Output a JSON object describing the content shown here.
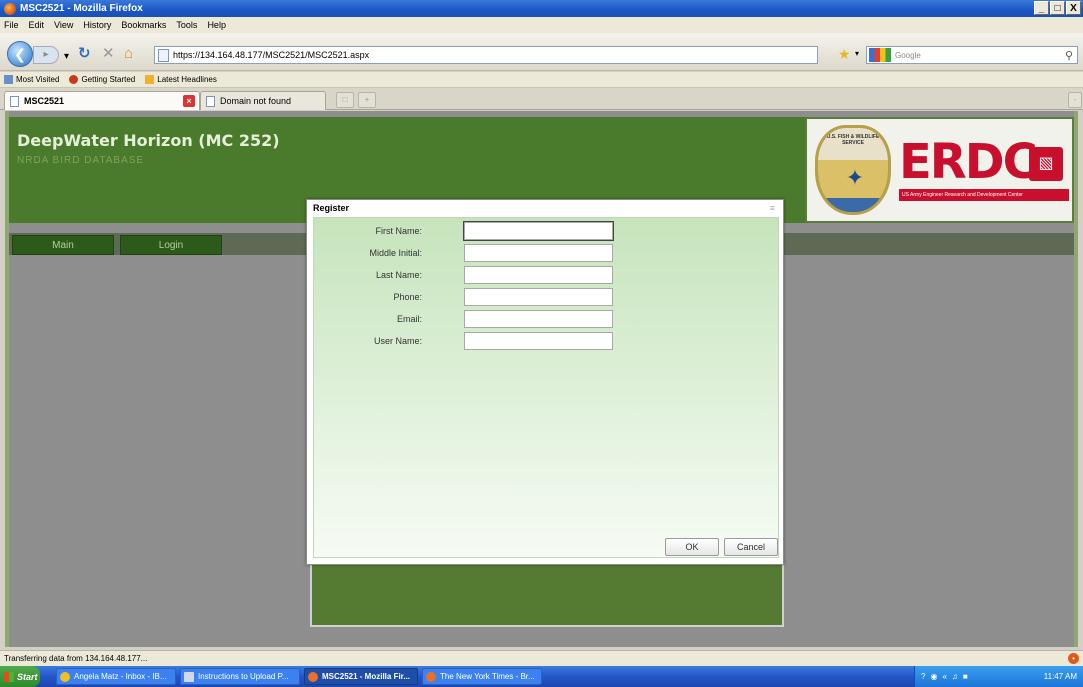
{
  "window": {
    "title": "MSC2521 - Mozilla Firefox",
    "controls": [
      "_",
      "□",
      "X"
    ]
  },
  "menu": [
    "File",
    "Edit",
    "View",
    "History",
    "Bookmarks",
    "Tools",
    "Help"
  ],
  "nav": {
    "url": "https://134.164.48.177/MSC2521/MSC2521.aspx",
    "search_placeholder": "Google"
  },
  "bookmarks": [
    "Most Visited",
    "Getting Started",
    "Latest Headlines"
  ],
  "tabs": [
    {
      "label": "MSC2521",
      "active": true
    },
    {
      "label": "Domain not found",
      "active": false
    }
  ],
  "page": {
    "title": "DeepWater Horizon (MC 252)",
    "subtitle": "NRDA BIRD DATABASE",
    "nav_buttons": [
      "Main",
      "Login"
    ],
    "logos": {
      "usfws_text": "U.S. FISH & WILDLIFE SERVICE",
      "erdc": "ERDC",
      "erdc_tagline": "US Army Engineer Research and Development Center"
    }
  },
  "dialog": {
    "title": "Register",
    "close_glyph": "≡",
    "fields": [
      {
        "label": "First Name:",
        "value": ""
      },
      {
        "label": "Middle Initial:",
        "value": ""
      },
      {
        "label": "Last Name:",
        "value": ""
      },
      {
        "label": "Phone:",
        "value": ""
      },
      {
        "label": "Email:",
        "value": ""
      },
      {
        "label": "User Name:",
        "value": ""
      }
    ],
    "ok_label": "OK",
    "cancel_label": "Cancel"
  },
  "status": {
    "text": "Transferring data from 134.164.48.177..."
  },
  "taskbar": {
    "start": "Start",
    "tasks": [
      {
        "label": "Angela Matz - Inbox - IB...",
        "color": "#f0c020"
      },
      {
        "label": "Instructions to Upload P...",
        "color": "#d0d8e8"
      },
      {
        "label": "MSC2521 - Mozilla Fir...",
        "color": "#e8702a",
        "active": true
      },
      {
        "label": "The New York Times - Br...",
        "color": "#e8702a"
      }
    ],
    "clock": "11:47 AM"
  }
}
